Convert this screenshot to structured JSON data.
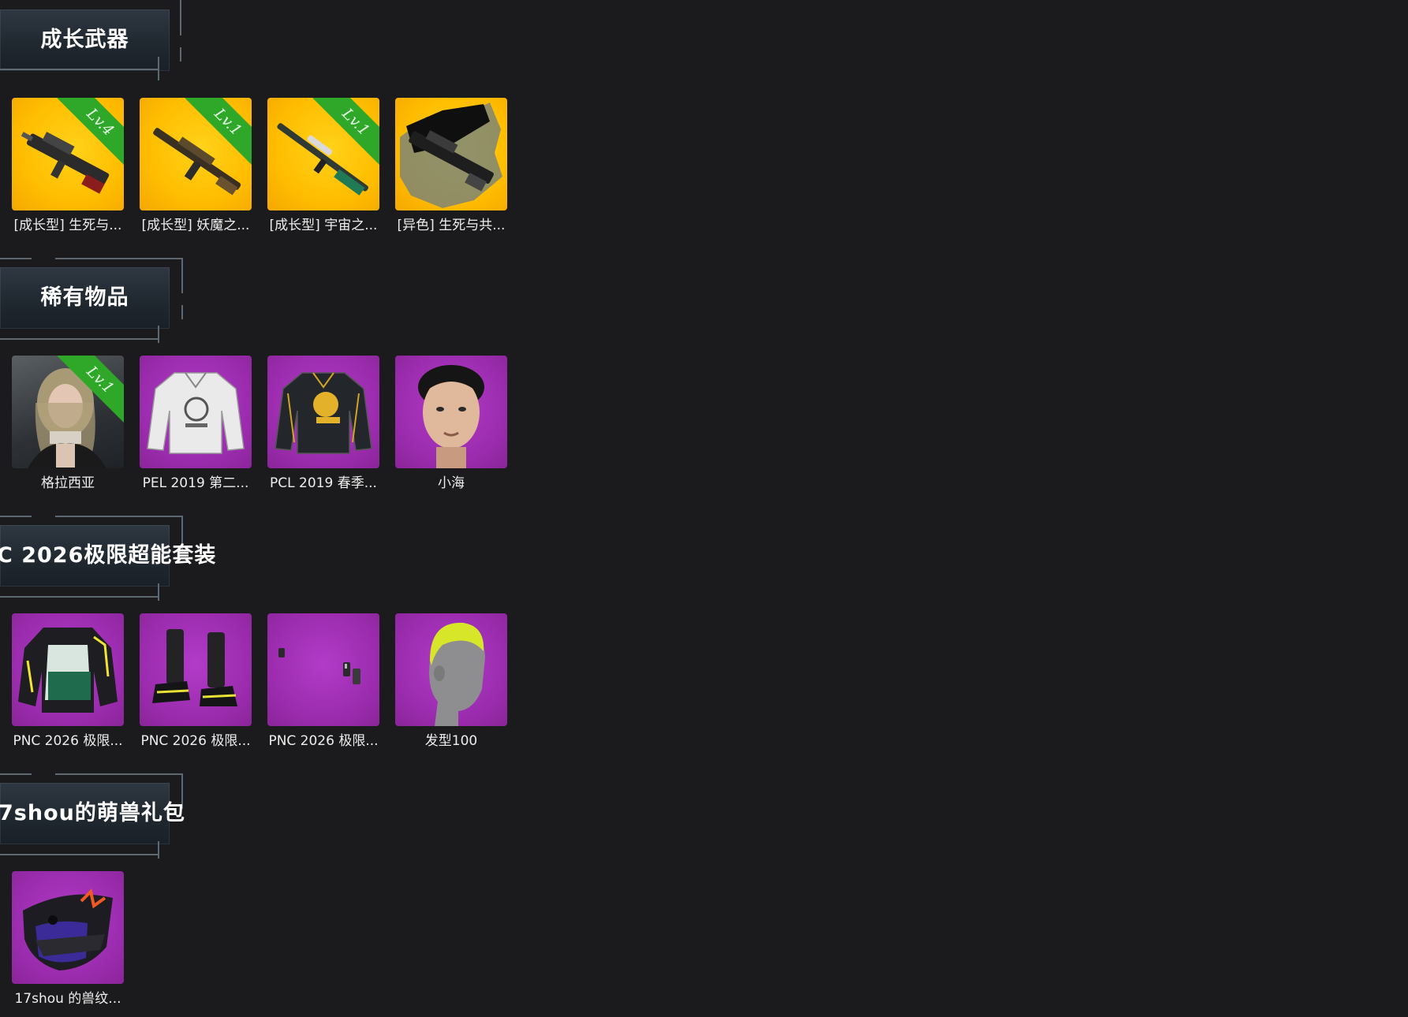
{
  "sections": [
    {
      "title": "成长武器",
      "items": [
        {
          "label": "[成长型] 生死与...",
          "badge": "Lv.4",
          "icon": "machine-gun-icon",
          "bg": "#ffbd00"
        },
        {
          "label": "[成长型] 妖魔之...",
          "badge": "Lv.1",
          "icon": "rifle-icon",
          "bg": "#ffbd00"
        },
        {
          "label": "[成长型] 宇宙之...",
          "badge": "Lv.1",
          "icon": "sniper-rifle-icon",
          "bg": "#ffbd00"
        },
        {
          "label": "[异色] 生死与共...",
          "badge": "",
          "icon": "machine-gun-variant-icon",
          "bg": "#ffbd00"
        }
      ]
    },
    {
      "title": "稀有物品",
      "items": [
        {
          "label": "格拉西亚",
          "badge": "Lv.1",
          "icon": "character-portrait-icon",
          "bg": "#3a3d41"
        },
        {
          "label": "PEL 2019 第二...",
          "badge": "",
          "icon": "white-jacket-icon",
          "bg": "#9b2cae"
        },
        {
          "label": "PCL 2019 春季...",
          "badge": "",
          "icon": "black-jacket-icon",
          "bg": "#9b2cae"
        },
        {
          "label": "小海",
          "badge": "",
          "icon": "face-icon",
          "bg": "#9b2cae"
        }
      ]
    },
    {
      "title": "C 2026极限超能套装",
      "items": [
        {
          "label": "PNC 2026 极限...",
          "badge": "",
          "icon": "armor-vest-icon",
          "bg": "#9b2cae"
        },
        {
          "label": "PNC 2026 极限...",
          "badge": "",
          "icon": "boots-icon",
          "bg": "#9b2cae"
        },
        {
          "label": "PNC 2026 极限...",
          "badge": "",
          "icon": "earrings-icon",
          "bg": "#9b2cae"
        },
        {
          "label": "发型100",
          "badge": "",
          "icon": "hairstyle-head-icon",
          "bg": "#9b2cae"
        }
      ]
    },
    {
      "title": "7shou的萌兽礼包",
      "items": [
        {
          "label": "17shou 的兽纹...",
          "badge": "",
          "icon": "beast-mask-icon",
          "bg": "#9b2cae"
        }
      ]
    }
  ]
}
